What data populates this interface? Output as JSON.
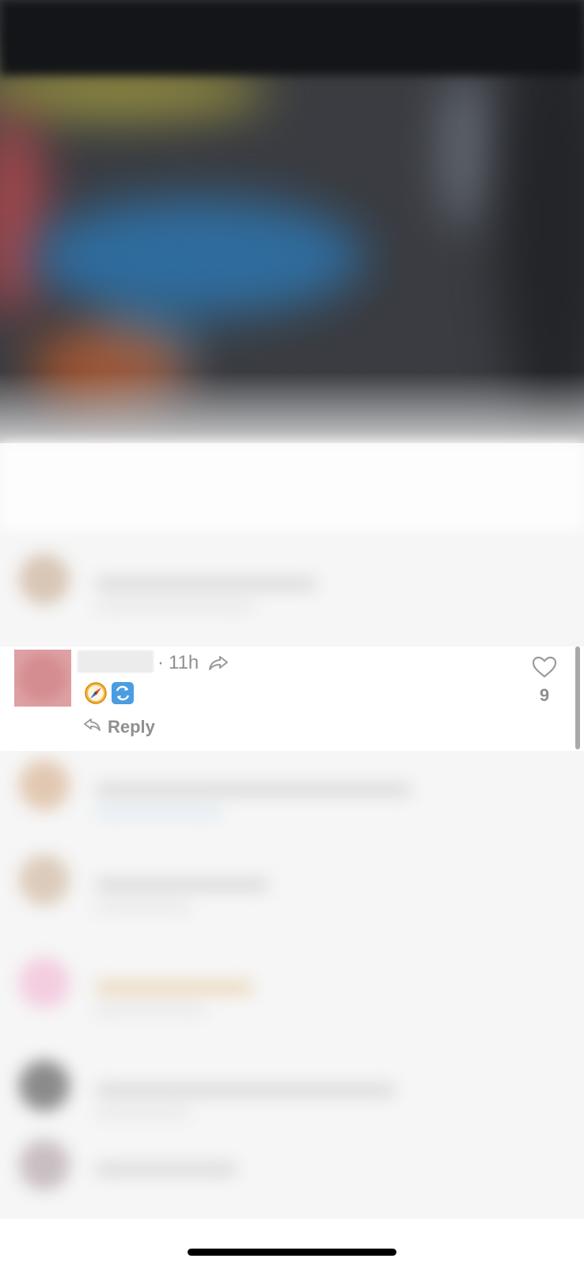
{
  "comment": {
    "time": "11h",
    "separator": "·",
    "emojis": [
      "compass-emoji",
      "repeat-button-emoji"
    ],
    "reply_label": "Reply",
    "like_count": "9"
  },
  "colors": {
    "meta_text": "#8f8f8f",
    "avatar_placeholder": "#dfa0a3",
    "home_indicator": "#000000"
  }
}
